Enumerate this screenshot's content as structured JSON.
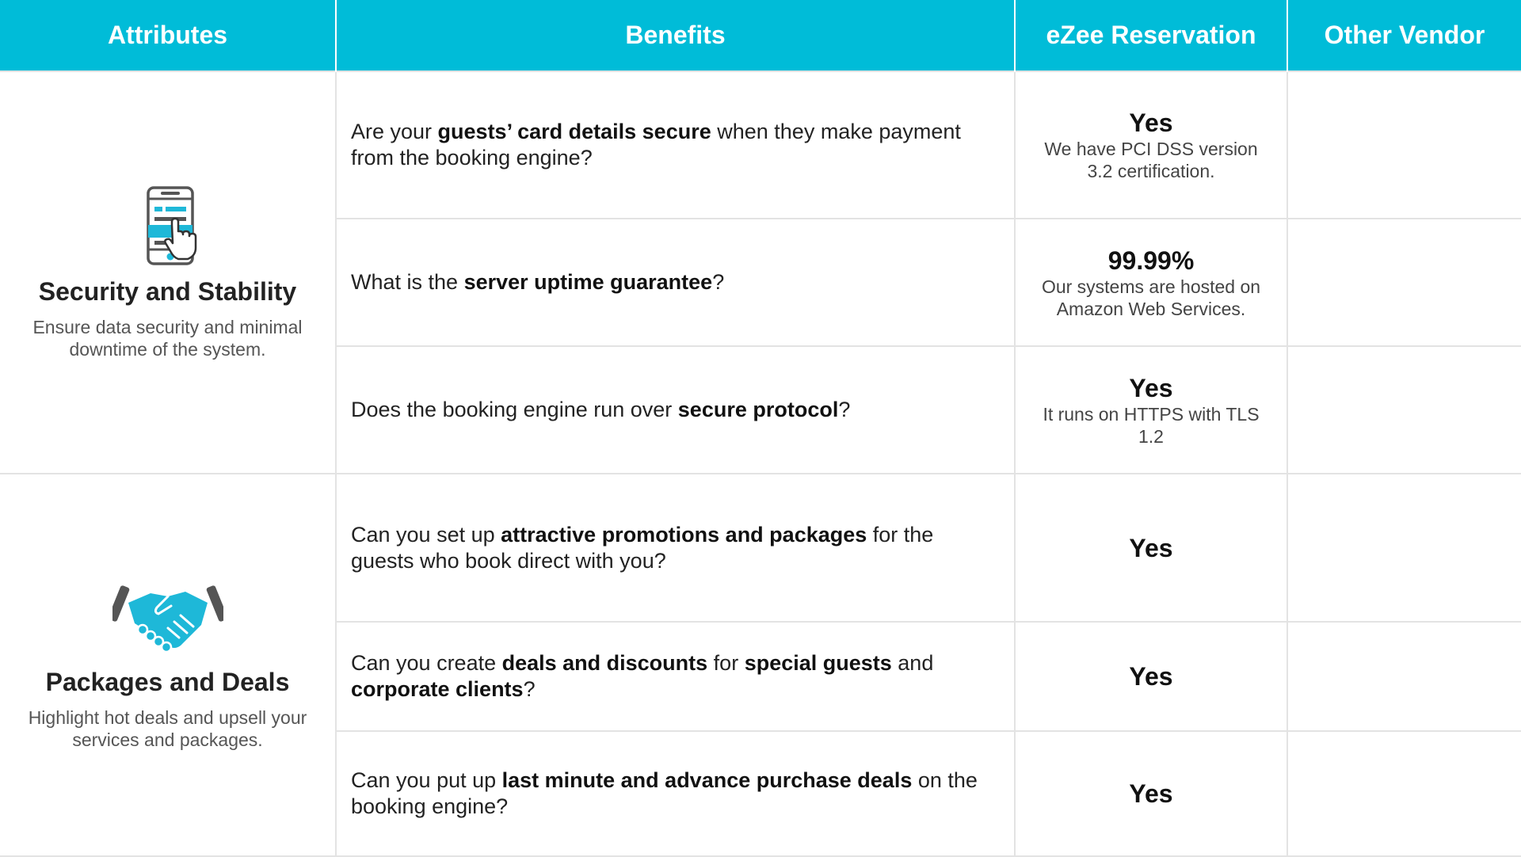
{
  "header": {
    "attributes": "Attributes",
    "benefits": "Benefits",
    "ezee": "eZee Reservation",
    "other": "Other Vendor"
  },
  "groups": [
    {
      "icon": "mobile-tap-icon",
      "title": "Security and Stability",
      "description": "Ensure data security and minimal downtime of the system.",
      "rows": [
        {
          "benefit": [
            {
              "t": "Are your "
            },
            {
              "t": "guests’ card details secure",
              "b": true
            },
            {
              "t": " when they make payment from the booking engine?"
            }
          ],
          "ezee_main": "Yes",
          "ezee_sub": "We have PCI DSS version 3.2 certification.",
          "other": ""
        },
        {
          "benefit": [
            {
              "t": "What is the "
            },
            {
              "t": "server uptime guarantee",
              "b": true
            },
            {
              "t": "?"
            }
          ],
          "ezee_main": "99.99%",
          "ezee_sub": "Our systems are hosted on Amazon Web Services.",
          "other": ""
        },
        {
          "benefit": [
            {
              "t": "Does the booking engine run over "
            },
            {
              "t": "secure protocol",
              "b": true
            },
            {
              "t": "?"
            }
          ],
          "ezee_main": "Yes",
          "ezee_sub": "It runs on HTTPS with TLS 1.2",
          "other": ""
        }
      ]
    },
    {
      "icon": "handshake-icon",
      "title": "Packages and Deals",
      "description": "Highlight hot deals and upsell your services and packages.",
      "rows": [
        {
          "benefit": [
            {
              "t": "Can you set up "
            },
            {
              "t": "attractive promotions and packages",
              "b": true
            },
            {
              "t": " for the guests who book direct with you?"
            }
          ],
          "ezee_main": "Yes",
          "ezee_sub": "",
          "other": ""
        },
        {
          "benefit": [
            {
              "t": "Can you create "
            },
            {
              "t": "deals and discounts",
              "b": true
            },
            {
              "t": " for "
            },
            {
              "t": "special guests",
              "b": true
            },
            {
              "t": " and "
            },
            {
              "t": "corporate clients",
              "b": true
            },
            {
              "t": "?"
            }
          ],
          "ezee_main": "Yes",
          "ezee_sub": "",
          "other": ""
        },
        {
          "benefit": [
            {
              "t": "Can you put up "
            },
            {
              "t": "last minute and advance purchase deals",
              "b": true
            },
            {
              "t": " on the booking engine?"
            }
          ],
          "ezee_main": "Yes",
          "ezee_sub": "",
          "other": ""
        }
      ]
    }
  ],
  "colors": {
    "header_bg": "#00bcd8",
    "header_text": "#ffffff",
    "icon_accent": "#1eb8d8",
    "icon_dark": "#555555",
    "border": "#e3e3e3"
  }
}
